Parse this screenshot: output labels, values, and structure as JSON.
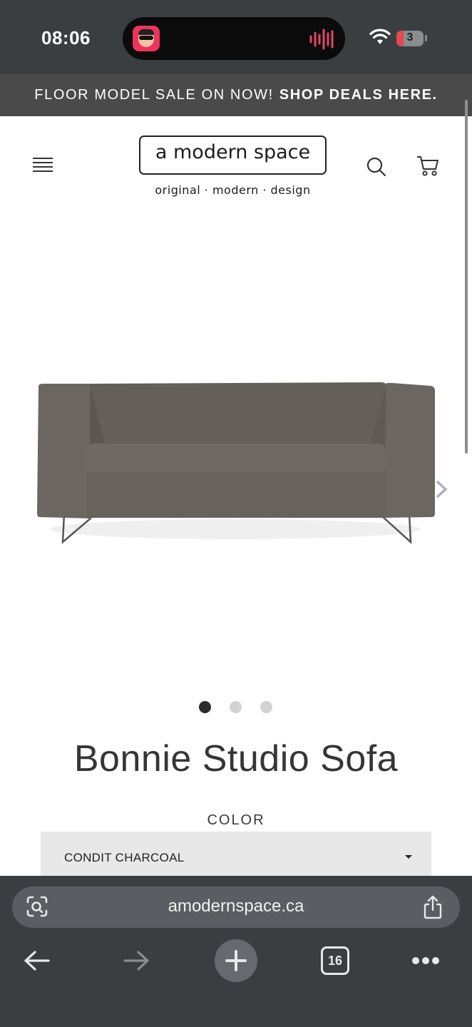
{
  "status": {
    "time": "08:06",
    "battery": "3"
  },
  "promo": {
    "text": "FLOOR MODEL SALE ON NOW!",
    "link": "SHOP DEALS HERE."
  },
  "header": {
    "logo": "a modern space",
    "tagline": "original · modern · design",
    "icons": [
      "menu-icon",
      "search-icon",
      "cart-icon"
    ]
  },
  "product": {
    "title": "Bonnie Studio Sofa",
    "color_label": "COLOR",
    "color_value": "CONDIT CHARCOAL",
    "carousel": {
      "slides": 3,
      "active": 1
    }
  },
  "browser": {
    "url": "amodernspace.ca",
    "tabs_count": "16"
  },
  "colors": {
    "chrome": "#3a3e41",
    "promo": "#4a4a4a",
    "sofa": "#6b6660",
    "island_app": "#f0335c"
  }
}
